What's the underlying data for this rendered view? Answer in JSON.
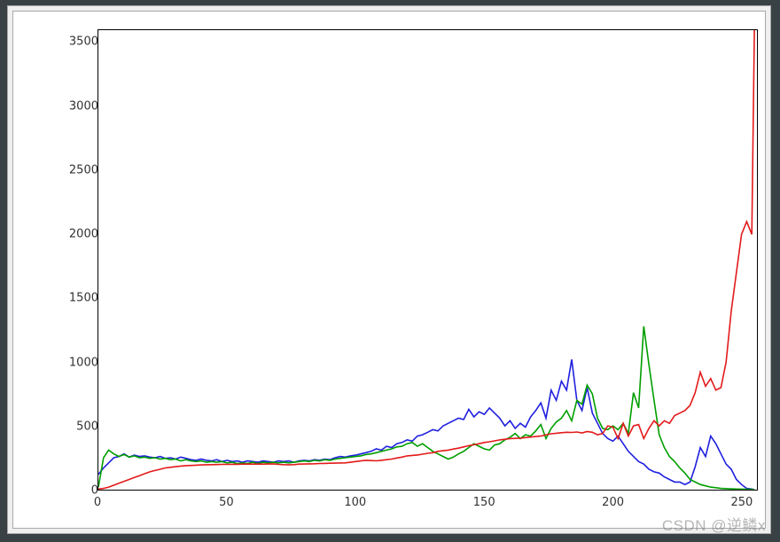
{
  "watermark": "CSDN @逆鳞x",
  "chart_data": {
    "type": "line",
    "xlabel": "",
    "ylabel": "",
    "xlim": [
      0,
      256
    ],
    "ylim": [
      0,
      3600
    ],
    "xticks": [
      0,
      50,
      100,
      150,
      200,
      250
    ],
    "yticks": [
      0,
      500,
      1000,
      1500,
      2000,
      2500,
      3000,
      3500
    ],
    "x": [
      0,
      2,
      4,
      6,
      8,
      10,
      12,
      14,
      16,
      18,
      20,
      22,
      24,
      26,
      28,
      30,
      32,
      34,
      36,
      38,
      40,
      42,
      44,
      46,
      48,
      50,
      52,
      54,
      56,
      58,
      60,
      62,
      64,
      66,
      68,
      70,
      72,
      74,
      76,
      78,
      80,
      82,
      84,
      86,
      88,
      90,
      92,
      94,
      96,
      98,
      100,
      102,
      104,
      106,
      108,
      110,
      112,
      114,
      116,
      118,
      120,
      122,
      124,
      126,
      128,
      130,
      132,
      134,
      136,
      138,
      140,
      142,
      144,
      146,
      148,
      150,
      152,
      154,
      156,
      158,
      160,
      162,
      164,
      166,
      168,
      170,
      172,
      174,
      176,
      178,
      180,
      182,
      184,
      186,
      188,
      190,
      192,
      194,
      196,
      198,
      200,
      202,
      204,
      206,
      208,
      210,
      212,
      214,
      216,
      218,
      220,
      222,
      224,
      226,
      228,
      230,
      232,
      234,
      236,
      238,
      240,
      242,
      244,
      246,
      248,
      250,
      252,
      254,
      255
    ],
    "series": [
      {
        "name": "blue",
        "color": "#1f1fe0",
        "values": [
          120,
          170,
          210,
          250,
          260,
          280,
          255,
          270,
          260,
          265,
          255,
          250,
          260,
          245,
          250,
          240,
          255,
          245,
          235,
          230,
          240,
          230,
          225,
          235,
          220,
          230,
          220,
          225,
          215,
          225,
          220,
          215,
          225,
          220,
          215,
          225,
          220,
          225,
          215,
          225,
          230,
          225,
          235,
          230,
          240,
          235,
          250,
          260,
          255,
          265,
          270,
          280,
          290,
          300,
          320,
          310,
          340,
          330,
          360,
          370,
          390,
          380,
          420,
          430,
          450,
          470,
          460,
          500,
          520,
          540,
          560,
          550,
          630,
          570,
          610,
          590,
          640,
          600,
          560,
          500,
          540,
          480,
          520,
          490,
          570,
          620,
          680,
          560,
          780,
          700,
          850,
          780,
          1020,
          700,
          620,
          800,
          600,
          520,
          440,
          400,
          380,
          420,
          360,
          300,
          260,
          220,
          200,
          160,
          140,
          130,
          100,
          80,
          60,
          60,
          40,
          60,
          180,
          330,
          260,
          420,
          360,
          280,
          200,
          160,
          80,
          40,
          10,
          5,
          0
        ]
      },
      {
        "name": "green",
        "color": "#009e00",
        "values": [
          20,
          250,
          310,
          280,
          260,
          275,
          255,
          265,
          250,
          255,
          245,
          250,
          240,
          245,
          235,
          240,
          225,
          235,
          225,
          220,
          225,
          215,
          220,
          215,
          220,
          210,
          215,
          205,
          210,
          205,
          215,
          205,
          215,
          210,
          215,
          210,
          215,
          210,
          215,
          220,
          225,
          220,
          230,
          225,
          235,
          230,
          240,
          245,
          250,
          255,
          260,
          265,
          275,
          280,
          290,
          300,
          310,
          320,
          335,
          340,
          360,
          370,
          340,
          360,
          330,
          300,
          280,
          260,
          240,
          255,
          280,
          300,
          330,
          360,
          340,
          320,
          310,
          350,
          360,
          390,
          410,
          440,
          400,
          430,
          420,
          460,
          510,
          400,
          480,
          530,
          560,
          620,
          540,
          700,
          670,
          820,
          750,
          560,
          480,
          470,
          500,
          470,
          520,
          440,
          760,
          640,
          1280,
          980,
          700,
          430,
          330,
          260,
          220,
          170,
          130,
          80,
          60,
          40,
          30,
          20,
          15,
          10,
          8,
          6,
          5,
          4,
          3,
          2,
          0
        ]
      },
      {
        "name": "red",
        "color": "#e31a1a",
        "values": [
          5,
          10,
          20,
          35,
          50,
          65,
          80,
          95,
          110,
          125,
          140,
          150,
          160,
          170,
          175,
          180,
          185,
          188,
          190,
          192,
          194,
          195,
          196,
          197,
          198,
          198,
          199,
          199,
          200,
          200,
          200,
          200,
          200,
          201,
          202,
          198,
          196,
          195,
          196,
          200,
          201,
          202,
          203,
          205,
          206,
          207,
          208,
          209,
          210,
          215,
          220,
          225,
          230,
          228,
          226,
          230,
          235,
          240,
          248,
          255,
          265,
          268,
          272,
          278,
          285,
          290,
          300,
          305,
          310,
          318,
          325,
          335,
          345,
          352,
          360,
          370,
          375,
          382,
          390,
          395,
          400,
          402,
          404,
          408,
          412,
          416,
          420,
          430,
          438,
          442,
          446,
          450,
          448,
          452,
          445,
          455,
          450,
          430,
          440,
          500,
          490,
          400,
          520,
          420,
          500,
          510,
          400,
          480,
          540,
          500,
          540,
          520,
          580,
          600,
          620,
          660,
          760,
          920,
          810,
          870,
          780,
          800,
          1000,
          1400,
          1700,
          2000,
          2100,
          2000,
          3600
        ]
      }
    ]
  }
}
